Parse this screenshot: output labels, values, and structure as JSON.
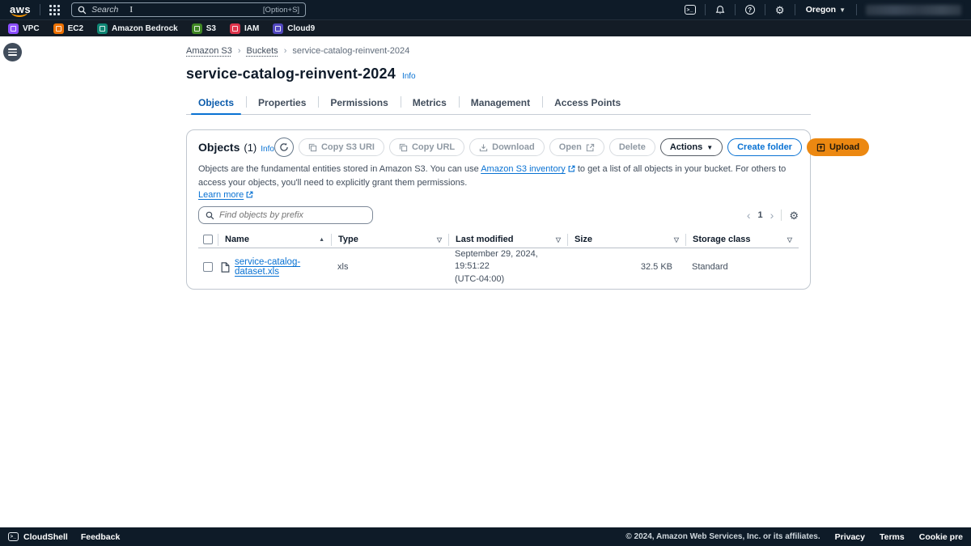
{
  "topbar": {
    "search_placeholder": "Search",
    "search_shortcut": "[Option+S]",
    "region": "Oregon"
  },
  "favorites": {
    "items": [
      {
        "label": "VPC",
        "color": "#8C4FFF"
      },
      {
        "label": "EC2",
        "color": "#ED7100"
      },
      {
        "label": "Amazon Bedrock",
        "color": "#0E8573"
      },
      {
        "label": "S3",
        "color": "#3F8624"
      },
      {
        "label": "IAM",
        "color": "#DD344C"
      },
      {
        "label": "Cloud9",
        "color": "#5147BE"
      }
    ]
  },
  "breadcrumb": {
    "item1": "Amazon S3",
    "item2": "Buckets",
    "item3": "service-catalog-reinvent-2024"
  },
  "page": {
    "title": "service-catalog-reinvent-2024",
    "info": "Info"
  },
  "tabs": {
    "items": [
      {
        "label": "Objects"
      },
      {
        "label": "Properties"
      },
      {
        "label": "Permissions"
      },
      {
        "label": "Metrics"
      },
      {
        "label": "Management"
      },
      {
        "label": "Access Points"
      }
    ]
  },
  "panel": {
    "title": "Objects",
    "count": "(1)",
    "info": "Info",
    "toolbar": {
      "copy_s3_uri": "Copy S3 URI",
      "copy_url": "Copy URL",
      "download": "Download",
      "open": "Open",
      "delete": "Delete",
      "actions": "Actions",
      "create_folder": "Create folder",
      "upload": "Upload"
    },
    "description": {
      "text1": "Objects are the fundamental entities stored in Amazon S3. You can use",
      "link1": "Amazon S3 inventory",
      "text2": "to get a list of all objects in your bucket. For others to access your objects, you'll need to explicitly grant them permissions.",
      "link2": "Learn more"
    },
    "search_placeholder": "Find objects by prefix",
    "pagination": {
      "page": "1"
    },
    "table": {
      "headers": {
        "name": "Name",
        "type": "Type",
        "last_modified": "Last modified",
        "size": "Size",
        "storage_class": "Storage class"
      },
      "rows": [
        {
          "name": "service-catalog-dataset.xls",
          "type": "xls",
          "modified_line1": "September 29, 2024, 19:51:22",
          "modified_line2": "(UTC-04:00)",
          "size": "32.5 KB",
          "storage_class": "Standard"
        }
      ]
    }
  },
  "footer": {
    "cloudshell": "CloudShell",
    "feedback": "Feedback",
    "copyright": "© 2024, Amazon Web Services, Inc. or its affiliates.",
    "privacy": "Privacy",
    "terms": "Terms",
    "cookie": "Cookie pre"
  },
  "icons": {
    "terminal": ">_",
    "gear": "⚙",
    "caret_down": "▼",
    "sort_asc": "▲",
    "filter": "▽",
    "chevron_left": "‹",
    "chevron_right": "›",
    "breadcrumb_sep": "›",
    "question": "?"
  },
  "colors": {
    "header_bg": "#0E1B28",
    "link_blue": "#0972D3",
    "accent_orange": "#EC8811",
    "active_tab": "#0B5BAB"
  }
}
